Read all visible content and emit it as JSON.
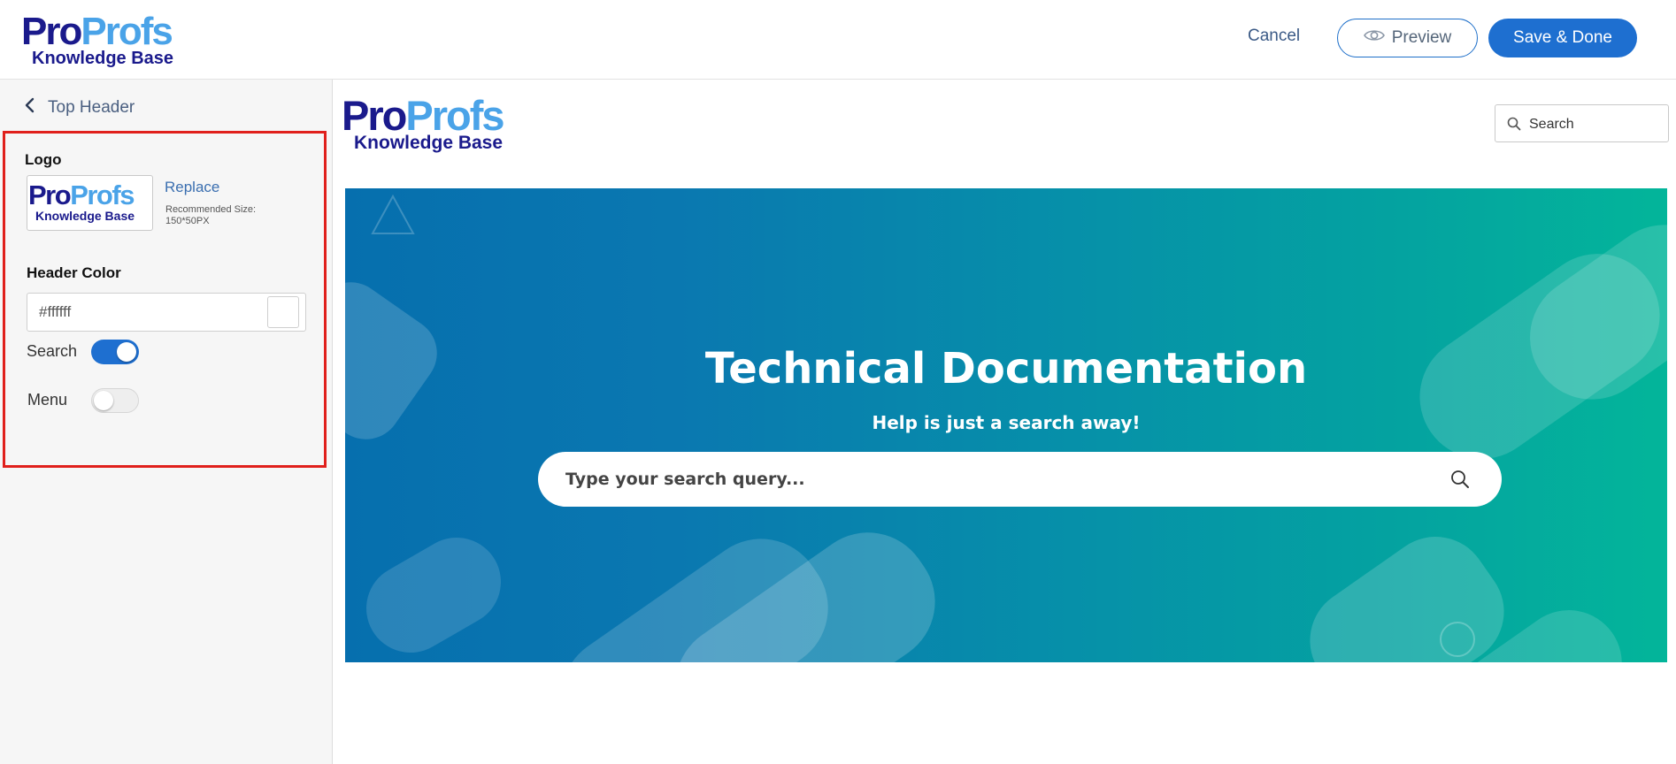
{
  "app": {
    "logo": {
      "brand_part1": "Pro",
      "brand_part2": "Profs",
      "sub": "Knowledge Base"
    }
  },
  "toolbar": {
    "cancel_label": "Cancel",
    "preview_label": "Preview",
    "save_label": "Save & Done"
  },
  "sidebar": {
    "back_label": "Top Header",
    "logo_section": {
      "title": "Logo",
      "thumb_brand_part1": "Pro",
      "thumb_brand_part2": "Profs",
      "thumb_sub": "Knowledge Base",
      "replace_label": "Replace",
      "recommended_line1": "Recommended Size:",
      "recommended_line2": "150*50PX"
    },
    "header_color": {
      "title": "Header Color",
      "value": "#ffffff"
    },
    "search_toggle": {
      "label": "Search",
      "on": true
    },
    "menu_toggle": {
      "label": "Menu",
      "on": false
    }
  },
  "preview": {
    "logo": {
      "brand_part1": "Pro",
      "brand_part2": "Profs",
      "sub": "Knowledge Base"
    },
    "header_search_placeholder": "Search",
    "hero": {
      "title": "Technical Documentation",
      "subtitle": "Help is just a search away!",
      "search_placeholder": "Type your search query..."
    }
  },
  "colors": {
    "accent": "#1e6fd0",
    "brand_dark": "#1a1a8c",
    "brand_light": "#4aa3e8",
    "highlight_border": "#e0201c"
  }
}
